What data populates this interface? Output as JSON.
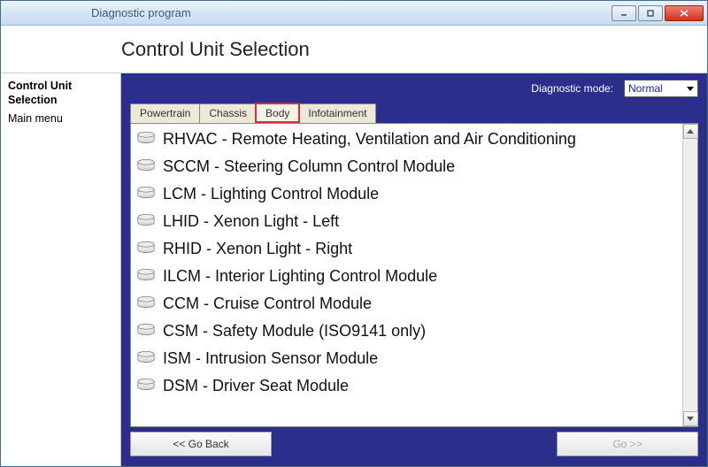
{
  "window": {
    "title": "Diagnostic program"
  },
  "header": {
    "page_title": "Control Unit Selection"
  },
  "sidebar": {
    "items": [
      {
        "label": "Control Unit Selection",
        "bold": true
      },
      {
        "label": "Main menu",
        "bold": false
      }
    ]
  },
  "mode": {
    "label": "Diagnostic mode:",
    "value": "Normal"
  },
  "tabs": [
    {
      "label": "Powertrain",
      "active": false
    },
    {
      "label": "Chassis",
      "active": false
    },
    {
      "label": "Body",
      "active": true
    },
    {
      "label": "Infotainment",
      "active": false
    }
  ],
  "modules": [
    "RHVAC - Remote Heating, Ventilation and Air Conditioning",
    "SCCM - Steering Column Control Module",
    "LCM - Lighting Control Module",
    "LHID - Xenon Light - Left",
    "RHID - Xenon Light - Right",
    "ILCM - Interior Lighting Control Module",
    "CCM - Cruise Control Module",
    "CSM - Safety Module (ISO9141 only)",
    "ISM - Intrusion Sensor Module",
    "DSM - Driver Seat Module"
  ],
  "footer": {
    "back": "<< Go Back",
    "go": "Go >>"
  }
}
